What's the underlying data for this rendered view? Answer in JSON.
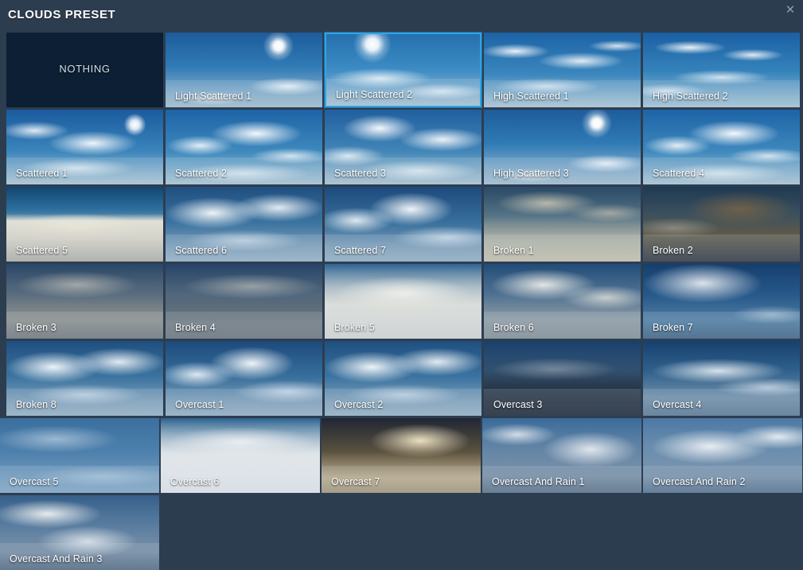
{
  "header": {
    "title": "CLOUDS PRESET",
    "close_icon": "close-icon",
    "close_glyph": "✕"
  },
  "colors": {
    "background": "#2d3d50",
    "selection_border": "#2da5e8",
    "nothing_tile": "#0c1f34",
    "label_text": "#ffffff",
    "title_text": "#ffffff",
    "close_icon": "#8d9aa8"
  },
  "grid": {
    "columns": 5,
    "rows": 7,
    "selected_index": 2,
    "tiles": [
      {
        "label": "NOTHING",
        "type": "nothing",
        "sky": ""
      },
      {
        "label": "Light Scattered 1",
        "type": "preset",
        "sky": "sky-clear-sun"
      },
      {
        "label": "Light Scattered 2",
        "type": "preset",
        "sky": "sky-sun-haze"
      },
      {
        "label": "High Scattered 1",
        "type": "preset",
        "sky": "sky-high-scattered"
      },
      {
        "label": "High Scattered 2",
        "type": "preset",
        "sky": "sky-high-scattered2"
      },
      {
        "label": "Scattered 1",
        "type": "preset",
        "sky": "sky-scattered-sun"
      },
      {
        "label": "Scattered 2",
        "type": "preset",
        "sky": "sky-scattered"
      },
      {
        "label": "Scattered 3",
        "type": "preset",
        "sky": "sky-scattered-dense"
      },
      {
        "label": "High Scattered 3",
        "type": "preset",
        "sky": "sky-clear-sun"
      },
      {
        "label": "Scattered 4",
        "type": "preset",
        "sky": "sky-scattered"
      },
      {
        "label": "Scattered 5",
        "type": "preset",
        "sky": "sky-above-clouds"
      },
      {
        "label": "Scattered 6",
        "type": "preset",
        "sky": "sky-cumulus"
      },
      {
        "label": "Scattered 7",
        "type": "preset",
        "sky": "sky-cumulus2"
      },
      {
        "label": "Broken 1",
        "type": "preset",
        "sky": "sky-broken-warm"
      },
      {
        "label": "Broken 2",
        "type": "preset",
        "sky": "sky-broken-dark"
      },
      {
        "label": "Broken 3",
        "type": "preset",
        "sky": "sky-broken-grey"
      },
      {
        "label": "Broken 4",
        "type": "preset",
        "sky": "sky-broken-grey2"
      },
      {
        "label": "Broken 5",
        "type": "preset",
        "sky": "sky-overcast-fog"
      },
      {
        "label": "Broken 6",
        "type": "preset",
        "sky": "sky-broken-bright"
      },
      {
        "label": "Broken 7",
        "type": "preset",
        "sky": "sky-broken-blue"
      },
      {
        "label": "Broken 8",
        "type": "preset",
        "sky": "sky-cumulus"
      },
      {
        "label": "Overcast 1",
        "type": "preset",
        "sky": "sky-cumulus2"
      },
      {
        "label": "Overcast 2",
        "type": "preset",
        "sky": "sky-cumulus"
      },
      {
        "label": "Overcast 3",
        "type": "preset",
        "sky": "sky-overcast-dark"
      },
      {
        "label": "Overcast 4",
        "type": "preset",
        "sky": "sky-overcast-layered"
      },
      {
        "label": "Overcast 5",
        "type": "preset",
        "sky": "sky-overcast-blue"
      },
      {
        "label": "Overcast 6",
        "type": "preset",
        "sky": "sky-fog-top"
      },
      {
        "label": "Overcast 7",
        "type": "preset",
        "sky": "sky-golden-sea"
      },
      {
        "label": "Overcast And Rain 1",
        "type": "preset",
        "sky": "sky-rain1"
      },
      {
        "label": "Overcast And Rain 2",
        "type": "preset",
        "sky": "sky-rain2"
      },
      {
        "label": "Overcast And Rain 3",
        "type": "preset",
        "sky": "sky-rain3"
      }
    ]
  }
}
